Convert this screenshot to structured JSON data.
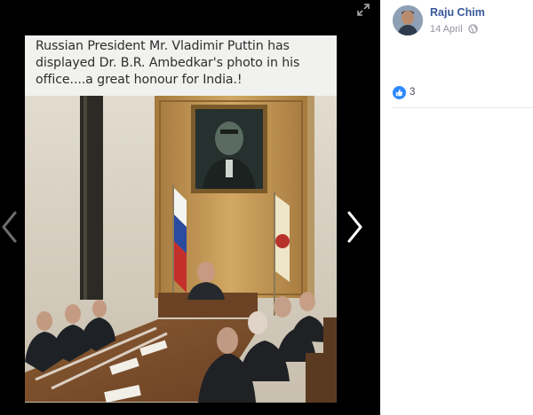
{
  "photo": {
    "caption": "Russian President Mr. Vladimir Puttin has displayed Dr. B.R. Ambedkar's photo in his office....a great honour for  India.!"
  },
  "viewer": {
    "expand_icon": "expand-icon",
    "prev_icon": "chevron-left-icon",
    "next_icon": "chevron-right-icon"
  },
  "post": {
    "author": "Raju Chim",
    "date": "14 April",
    "privacy_icon": "globe-icon",
    "reactions": {
      "icon": "like-icon",
      "count": "3"
    }
  },
  "colors": {
    "viewer_bg": "#000000",
    "author_link": "#385898",
    "like_blue": "#2d88ff",
    "meta_gray": "#90949c"
  }
}
